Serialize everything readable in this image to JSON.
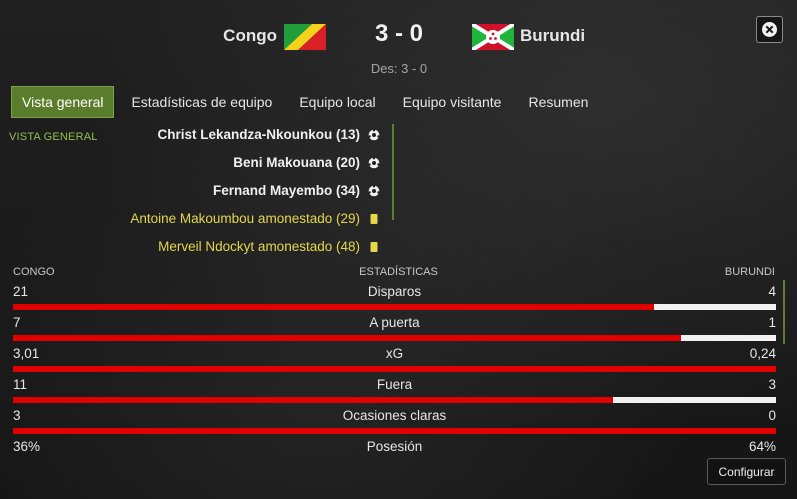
{
  "header": {
    "home_team": "Congo",
    "away_team": "Burundi",
    "score": "3 - 0",
    "halftime": "Des: 3 - 0",
    "close_icon": "close-icon"
  },
  "tabs": [
    {
      "label": "Vista general",
      "active": true
    },
    {
      "label": "Estadísticas de equipo",
      "active": false
    },
    {
      "label": "Equipo local",
      "active": false
    },
    {
      "label": "Equipo visitante",
      "active": false
    },
    {
      "label": "Resumen",
      "active": false
    }
  ],
  "overview": {
    "section_label": "VISTA GENERAL",
    "events": [
      {
        "text": "Christ Lekandza-Nkounkou (13)",
        "type": "goal",
        "icon": "football-icon"
      },
      {
        "text": "Beni Makouana (20)",
        "type": "goal",
        "icon": "football-icon"
      },
      {
        "text": "Fernand Mayembo (34)",
        "type": "goal",
        "icon": "football-icon"
      },
      {
        "text": "Antoine Makoumbou amonestado (29)",
        "type": "card",
        "icon": "yellow-card-icon"
      },
      {
        "text": "Merveil Ndockyt amonestado (48)",
        "type": "card",
        "icon": "yellow-card-icon"
      }
    ]
  },
  "stats": {
    "home_label": "CONGO",
    "title": "ESTADÍSTICAS",
    "away_label": "BURUNDI",
    "rows": [
      {
        "label": "Disparos",
        "home": "21",
        "away": "4",
        "home_share": 0.84
      },
      {
        "label": "A puerta",
        "home": "7",
        "away": "1",
        "home_share": 0.875
      },
      {
        "label": "xG",
        "home": "3,01",
        "away": "0,24",
        "home_share": 1.0
      },
      {
        "label": "Fuera",
        "home": "11",
        "away": "3",
        "home_share": 0.786
      },
      {
        "label": "Ocasiones claras",
        "home": "3",
        "away": "0",
        "home_share": 1.0
      },
      {
        "label": "Posesión",
        "home": "36%",
        "away": "64%",
        "home_share": null
      }
    ]
  },
  "configure_button": "Configurar",
  "colors": {
    "accent_green": "#5a7d2b",
    "home_bar": "#e00000",
    "away_bar": "#f2f2f2",
    "card_yellow": "#e4d74a"
  }
}
